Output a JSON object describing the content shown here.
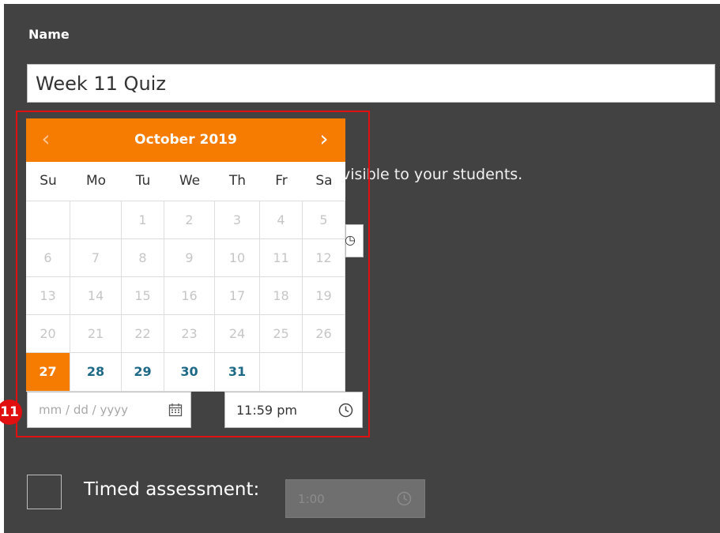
{
  "form": {
    "name_label": "Name",
    "name_value": "Week 11 Quiz",
    "visible_text_fragment": "visible to your students.",
    "hidden_time_fragment": "⏲"
  },
  "calendar": {
    "month_title": "October 2019",
    "prev_icon": "chevron-left-icon",
    "next_icon": "chevron-right-icon",
    "prev_symbol": "‹",
    "next_symbol": "›",
    "weekdays": [
      "Su",
      "Mo",
      "Tu",
      "We",
      "Th",
      "Fr",
      "Sa"
    ],
    "weeks": [
      [
        "",
        "",
        "1",
        "2",
        "3",
        "4",
        "5"
      ],
      [
        "6",
        "7",
        "8",
        "9",
        "10",
        "11",
        "12"
      ],
      [
        "13",
        "14",
        "15",
        "16",
        "17",
        "18",
        "19"
      ],
      [
        "20",
        "21",
        "22",
        "23",
        "24",
        "25",
        "26"
      ],
      [
        "27",
        "28",
        "29",
        "30",
        "31",
        "",
        ""
      ]
    ],
    "selected_day": "27",
    "enabled_days": [
      "27",
      "28",
      "29",
      "30",
      "31"
    ],
    "colors": {
      "header": "#f57c00",
      "selected": "#f57c00",
      "enabled_text": "#1e6a86",
      "disabled_text": "#c6c6c6"
    }
  },
  "date_field": {
    "placeholder": "mm / dd / yyyy",
    "icon": "calendar-icon"
  },
  "time_field": {
    "value": "11:59 pm",
    "icon": "clock-icon"
  },
  "annotation": {
    "step_number": "11",
    "color": "#e01010"
  },
  "timed_assessment": {
    "label": "Timed assessment:",
    "checked": false,
    "value": "1:00",
    "icon": "clock-icon"
  }
}
